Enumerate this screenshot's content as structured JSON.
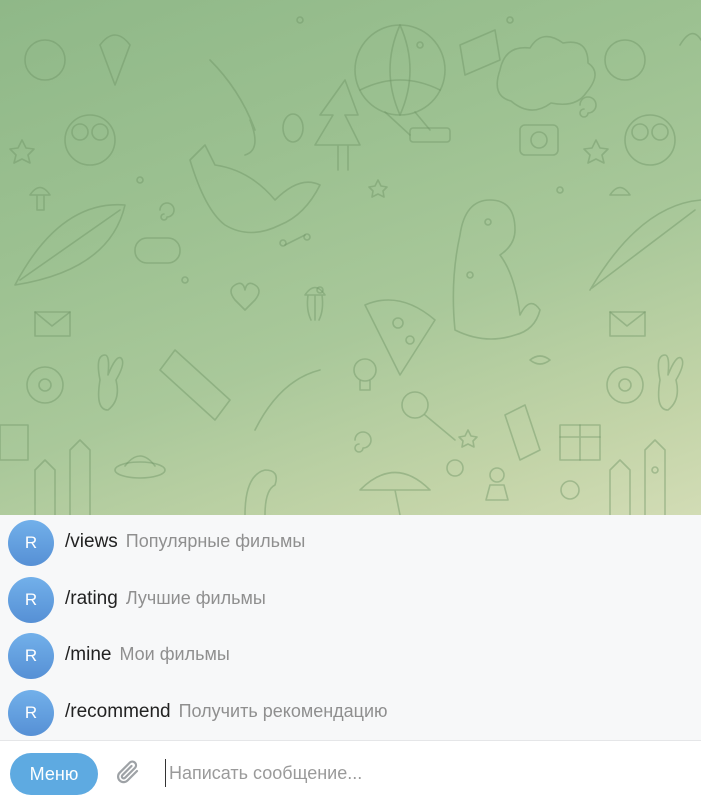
{
  "chat": {
    "background_gradient": [
      "#8fb888",
      "#a9c89a",
      "#d2dcb5"
    ],
    "doodle_color": "#6f9465"
  },
  "commands": [
    {
      "avatar_letter": "R",
      "command": "/views",
      "description": "Популярные фильмы"
    },
    {
      "avatar_letter": "R",
      "command": "/rating",
      "description": "Лучшие фильмы"
    },
    {
      "avatar_letter": "R",
      "command": "/mine",
      "description": "Мои фильмы"
    },
    {
      "avatar_letter": "R",
      "command": "/recommend",
      "description": "Получить рекомендацию"
    }
  ],
  "composer": {
    "menu_label": "Меню",
    "attach_icon": "paperclip-icon",
    "placeholder": "Написать сообщение..."
  },
  "colors": {
    "accent": "#5eaae1",
    "avatar": "#5c98d9",
    "panel": "#f7f8f9"
  }
}
